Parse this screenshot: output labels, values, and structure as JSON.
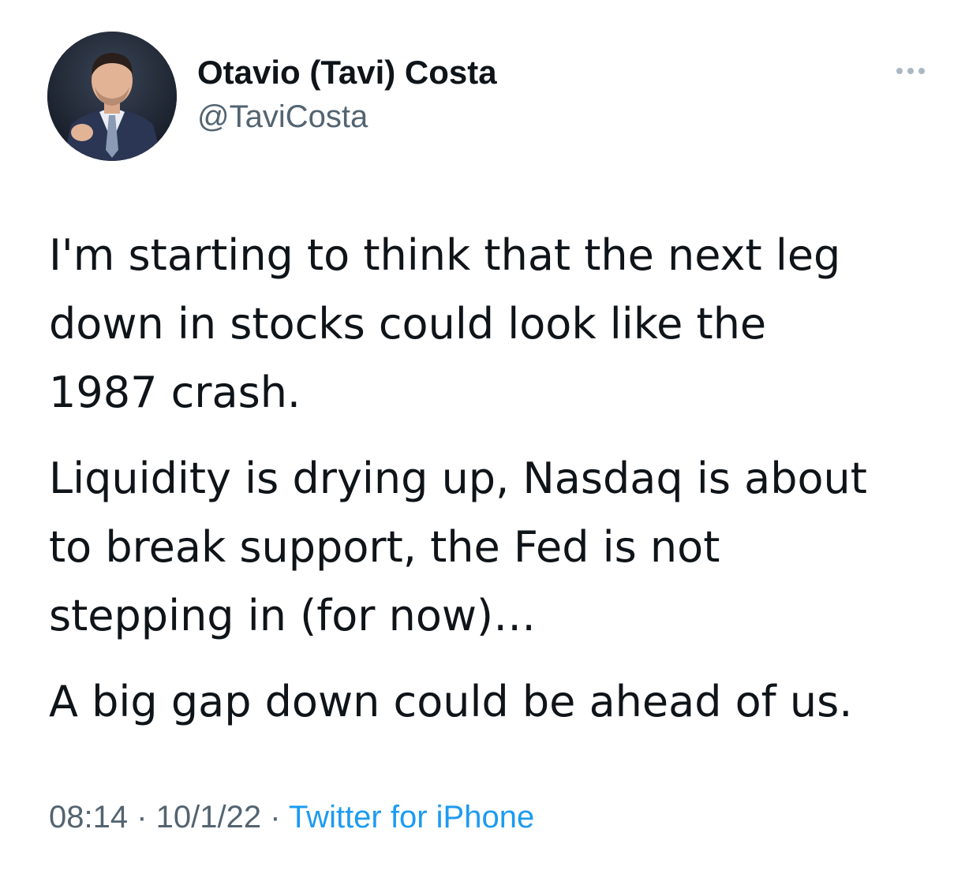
{
  "author": {
    "display_name": "Otavio (Tavi) Costa",
    "handle": "@TaviCosta",
    "avatar_icon": "profile-photo"
  },
  "more_icon": "ellipsis-icon",
  "tweet": {
    "paragraphs": [
      "I'm starting to think that the next leg\ndown in stocks could look like the\n1987 crash.",
      "Liquidity is drying up, Nasdaq is about\nto break support, the Fed is not\nstepping in (for now)…",
      "A big gap down could be ahead of us."
    ]
  },
  "meta": {
    "time": "08:14",
    "separator": " · ",
    "date": "10/1/22",
    "source": "Twitter for iPhone"
  },
  "colors": {
    "text_primary": "#0f1419",
    "text_secondary": "#536471",
    "link": "#1d9bf0"
  }
}
